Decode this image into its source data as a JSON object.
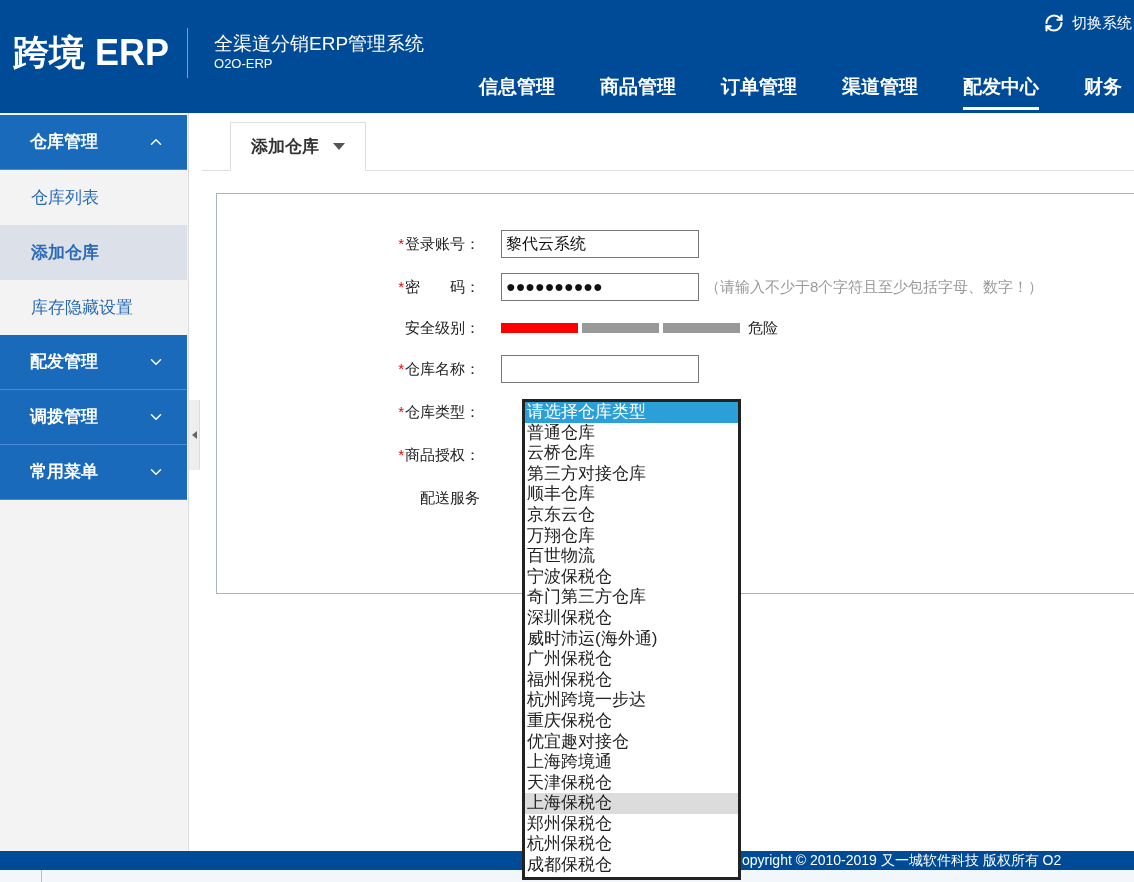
{
  "header": {
    "logo": "跨境 ERP",
    "title": "全渠道分销ERP管理系统",
    "subtitle": "O2O-ERP",
    "switch_label": "切换系统",
    "nav": [
      {
        "label": "信息管理",
        "selected": false
      },
      {
        "label": "商品管理",
        "selected": false
      },
      {
        "label": "订单管理",
        "selected": false
      },
      {
        "label": "渠道管理",
        "selected": false
      },
      {
        "label": "配发中心",
        "selected": true
      },
      {
        "label": "财务",
        "selected": false
      }
    ]
  },
  "sidebar": {
    "groups": [
      {
        "label": "仓库管理",
        "expanded": true,
        "children": [
          {
            "label": "仓库列表",
            "selected": false
          },
          {
            "label": "添加仓库",
            "selected": true
          },
          {
            "label": "库存隐藏设置",
            "selected": false
          }
        ]
      },
      {
        "label": "配发管理",
        "expanded": false
      },
      {
        "label": "调拨管理",
        "expanded": false
      },
      {
        "label": "常用菜单",
        "expanded": false
      }
    ]
  },
  "tabs": [
    {
      "label": "添加仓库",
      "selected": true
    }
  ],
  "form": {
    "fields": [
      {
        "kind": "text",
        "mark": "*",
        "label": "登录账号：",
        "value": "黎代云系统"
      },
      {
        "kind": "password",
        "mark": "*",
        "label": "密　　码：",
        "value": "●●●●●●●●●●",
        "hint": "（请输入不少于8个字符且至少包括字母、数字！）"
      },
      {
        "kind": "strength",
        "label": "安全级别：",
        "level": 0.333,
        "reading": "危险"
      },
      {
        "kind": "text",
        "mark": "*",
        "label": "仓库名称："
      },
      {
        "kind": "listbox",
        "mark": "*",
        "label": "仓库类型：",
        "options": [
          {
            "label": "请选择仓库类型",
            "selected": true,
            "hovered": false
          },
          {
            "label": "普通仓库",
            "selected": false,
            "hovered": false
          },
          {
            "label": "云桥仓库",
            "selected": false,
            "hovered": false
          },
          {
            "label": "第三方对接仓库",
            "selected": false,
            "hovered": false
          },
          {
            "label": "顺丰仓库",
            "selected": false,
            "hovered": false
          },
          {
            "label": "京东云仓",
            "selected": false,
            "hovered": false
          },
          {
            "label": "万翔仓库",
            "selected": false,
            "hovered": false
          },
          {
            "label": "百世物流",
            "selected": false,
            "hovered": false
          },
          {
            "label": "宁波保税仓",
            "selected": false,
            "hovered": false
          },
          {
            "label": "奇门第三方仓库",
            "selected": false,
            "hovered": false
          },
          {
            "label": "深圳保税仓",
            "selected": false,
            "hovered": false
          },
          {
            "label": "威时沛运(海外通)",
            "selected": false,
            "hovered": false
          },
          {
            "label": "广州保税仓",
            "selected": false,
            "hovered": false
          },
          {
            "label": "福州保税仓",
            "selected": false,
            "hovered": false
          },
          {
            "label": "杭州跨境一步达",
            "selected": false,
            "hovered": false
          },
          {
            "label": "重庆保税仓",
            "selected": false,
            "hovered": false
          },
          {
            "label": "优宜趣对接仓",
            "selected": false,
            "hovered": false
          },
          {
            "label": "上海跨境通",
            "selected": false,
            "hovered": false
          },
          {
            "label": "天津保税仓",
            "selected": false,
            "hovered": false
          },
          {
            "label": "上海保税仓",
            "selected": false,
            "hovered": true
          },
          {
            "label": "郑州保税仓",
            "selected": false,
            "hovered": false
          },
          {
            "label": "杭州保税仓",
            "selected": false,
            "hovered": false
          },
          {
            "label": "成都保税仓",
            "selected": false,
            "hovered": false
          }
        ]
      },
      {
        "kind": "plain",
        "mark": "*",
        "label": "商品授权："
      },
      {
        "kind": "plain",
        "label": "配送服务"
      }
    ]
  },
  "footer": {
    "text": "opyright © 2010-2019 又一城软件科技 版权所有 O2"
  }
}
